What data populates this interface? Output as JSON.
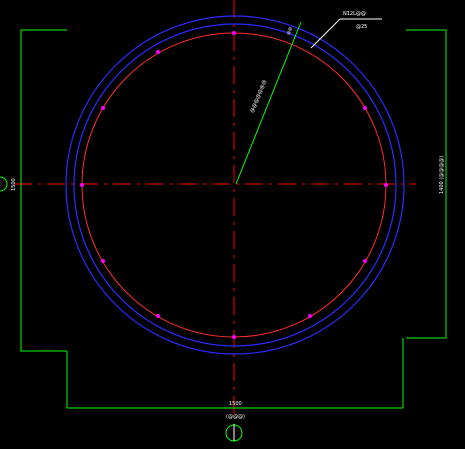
{
  "drawing": {
    "colors": {
      "background": "#000000",
      "outer_ring": "#2b2bff",
      "inner_ring": "#ff2d2d",
      "centerline": "#ff0000",
      "dimension": "#00ff00",
      "leader": "#00ff00",
      "text": "#ffffff",
      "marker": "#ff00ff"
    },
    "labels": {
      "top_leader_line1": "N12L@@",
      "top_leader_line2": "@25",
      "top_leader_small": "@@",
      "radius_label": "@@@@@@@",
      "right_dimension": "1400 (@@@@)",
      "left_dimension": "1500",
      "bottom_dimension_line1": "1500",
      "bottom_dimension_line2": "(@@@)"
    },
    "bubbles": {
      "left": "",
      "bottom": ""
    }
  }
}
